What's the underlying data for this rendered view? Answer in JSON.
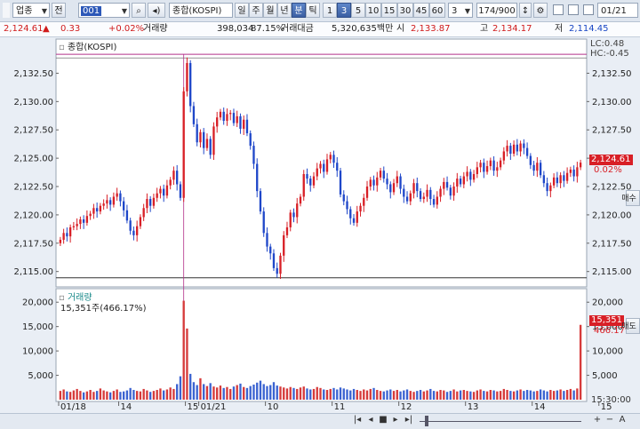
{
  "toolbar": {
    "market_label": "업종",
    "mode_label": "전",
    "code_value": "001",
    "index_name": "종합(KOSPI)",
    "periods": [
      "일",
      "주",
      "월",
      "년",
      "분",
      "틱"
    ],
    "active_period": "분",
    "intervals": [
      "1",
      "3",
      "5",
      "10",
      "15",
      "30",
      "45",
      "60"
    ],
    "active_interval": "3",
    "interval_select": "3",
    "bar_count": "174/900",
    "date_value": "01/21"
  },
  "quote": {
    "price": "2,124.61",
    "change_arrow": "▲",
    "change": "0.33",
    "change_pct": "+0.02%",
    "volume_label": "거래량",
    "volume": "398,034",
    "volume_ratio": "87.15%",
    "amount_label": "거래대금",
    "amount": "5,320,635백만",
    "open_label": "시",
    "open": "2,133.87",
    "high_label": "고",
    "high": "2,134.17",
    "low_label": "저",
    "low": "2,114.45"
  },
  "side": {
    "buy_label": "매수",
    "sell_label": "매도",
    "lc": "LC:0.48",
    "hc": "HC:-0.45",
    "price_badge": "2,124.61",
    "price_badge_pct": "0.02%",
    "volume_badge": "15,351",
    "volume_badge_pct": "466.17%",
    "time_label": "15:30:00"
  },
  "colors": {
    "up": "#d81f26",
    "down": "#1f47c9",
    "volume_up": "#d63a3a",
    "volume_down": "#3b63d1",
    "marker_line": "#b4328a"
  },
  "chart_data": {
    "type": "candlestick",
    "price_panel": {
      "title": "종합(KOSPI)",
      "y_ticks": [
        "2,132.50",
        "2,130.00",
        "2,127.50",
        "2,125.00",
        "2,122.50",
        "2,120.00",
        "2,117.50",
        "2,115.00"
      ],
      "y_tick_values": [
        2132.5,
        2130.0,
        2127.5,
        2125.0,
        2122.5,
        2120.0,
        2117.5,
        2115.0
      ],
      "ylim": [
        2113.8,
        2135.2
      ],
      "reference_lines": [
        2134.17,
        2114.45
      ],
      "closes": [
        2117.8,
        2118.4,
        2118.1,
        2118.9,
        2119.0,
        2119.2,
        2119.6,
        2119.3,
        2119.9,
        2120.1,
        2120.6,
        2120.3,
        2120.8,
        2121.0,
        2121.3,
        2120.9,
        2121.6,
        2121.9,
        2121.2,
        2120.4,
        2119.5,
        2118.6,
        2118.2,
        2119.0,
        2119.8,
        2120.6,
        2121.4,
        2120.8,
        2121.5,
        2121.9,
        2122.3,
        2121.7,
        2122.6,
        2123.1,
        2123.9,
        2122.7,
        2121.5,
        2130.9,
        2133.4,
        2129.6,
        2128.0,
        2126.4,
        2127.3,
        2125.9,
        2126.7,
        2125.3,
        2127.8,
        2128.6,
        2129.1,
        2128.3,
        2128.9,
        2129.0,
        2128.1,
        2128.7,
        2127.6,
        2128.4,
        2127.2,
        2126.1,
        2124.5,
        2122.1,
        2120.3,
        2118.4,
        2117.2,
        2116.6,
        2115.3,
        2114.8,
        2116.4,
        2118.2,
        2118.9,
        2120.2,
        2119.8,
        2121.0,
        2121.6,
        2123.6,
        2123.2,
        2122.6,
        2123.4,
        2124.1,
        2124.5,
        2123.8,
        2124.9,
        2125.3,
        2124.6,
        2123.9,
        2121.8,
        2121.2,
        2120.5,
        2119.7,
        2119.3,
        2120.3,
        2120.8,
        2121.5,
        2122.5,
        2123.1,
        2122.6,
        2123.3,
        2123.9,
        2123.2,
        2122.7,
        2122.0,
        2122.8,
        2123.4,
        2122.3,
        2121.6,
        2121.2,
        2121.9,
        2122.8,
        2122.1,
        2121.4,
        2121.6,
        2122.2,
        2121.4,
        2120.9,
        2121.6,
        2122.3,
        2122.9,
        2122.4,
        2121.7,
        2122.5,
        2123.2,
        2122.7,
        2123.4,
        2123.8,
        2123.1,
        2123.6,
        2124.2,
        2124.6,
        2123.8,
        2124.3,
        2124.8,
        2123.9,
        2124.2,
        2124.8,
        2125.6,
        2126.1,
        2125.4,
        2126.2,
        2125.6,
        2126.3,
        2125.9,
        2125.2,
        2124.4,
        2123.9,
        2124.6,
        2123.5,
        2122.8,
        2122.1,
        2122.6,
        2123.3,
        2122.8,
        2123.5,
        2123.0,
        2123.7,
        2124.0,
        2123.4,
        2124.2,
        2124.61
      ]
    },
    "volume_panel": {
      "title": "거래량",
      "legend_value": "15,351주(466.17%)",
      "y_ticks": [
        "20,000",
        "15,000",
        "10,000",
        "5,000"
      ],
      "y_tick_values": [
        20000,
        15000,
        10000,
        5000
      ],
      "ylim": [
        0,
        21500
      ],
      "values": [
        1800,
        2100,
        1700,
        1600,
        1900,
        2200,
        1800,
        1500,
        1700,
        2000,
        1600,
        1800,
        2300,
        1900,
        1700,
        1500,
        1800,
        2100,
        1600,
        1700,
        1900,
        2400,
        2000,
        1800,
        1700,
        2200,
        1900,
        1600,
        1800,
        2000,
        2300,
        1900,
        2100,
        2500,
        2200,
        3200,
        4800,
        20300,
        14600,
        5300,
        3600,
        3000,
        4400,
        3200,
        2800,
        3400,
        2700,
        2500,
        2900,
        2400,
        2600,
        2200,
        2700,
        3000,
        3300,
        2600,
        2400,
        2800,
        3100,
        3500,
        3900,
        3200,
        2800,
        3000,
        3600,
        2900,
        2700,
        2500,
        2300,
        2600,
        2400,
        2200,
        2500,
        2700,
        2300,
        2100,
        2200,
        2600,
        2400,
        2100,
        2000,
        2200,
        2400,
        2100,
        2500,
        2300,
        2100,
        1900,
        2200,
        2000,
        1800,
        2100,
        1900,
        2200,
        2400,
        2000,
        1800,
        1700,
        1900,
        2100,
        1800,
        2000,
        1700,
        1900,
        2100,
        1800,
        1600,
        1800,
        2000,
        1700,
        1900,
        2200,
        1800,
        1700,
        2000,
        1900,
        1600,
        1800,
        2100,
        1700,
        1900,
        2000,
        1800,
        1700,
        1600,
        1900,
        2100,
        1800,
        1700,
        2000,
        1900,
        1700,
        1800,
        2200,
        2000,
        1800,
        1700,
        1900,
        2100,
        1800,
        2000,
        1900,
        1700,
        1800,
        2100,
        1900,
        1700,
        2000,
        1800,
        1900,
        2100,
        1800,
        2000,
        2200,
        1900,
        2300,
        15351
      ]
    },
    "x_ticks": [
      {
        "label": "01/18",
        "index": 0
      },
      {
        "label": "14",
        "index": 18
      },
      {
        "label": "15",
        "index": 38
      },
      {
        "label": "01/21",
        "index": 42
      },
      {
        "label": "10",
        "index": 62
      },
      {
        "label": "11",
        "index": 82
      },
      {
        "label": "12",
        "index": 102
      },
      {
        "label": "13",
        "index": 122
      },
      {
        "label": "14",
        "index": 142
      },
      {
        "label": "15",
        "index": 162
      }
    ],
    "marker_index": 37
  }
}
